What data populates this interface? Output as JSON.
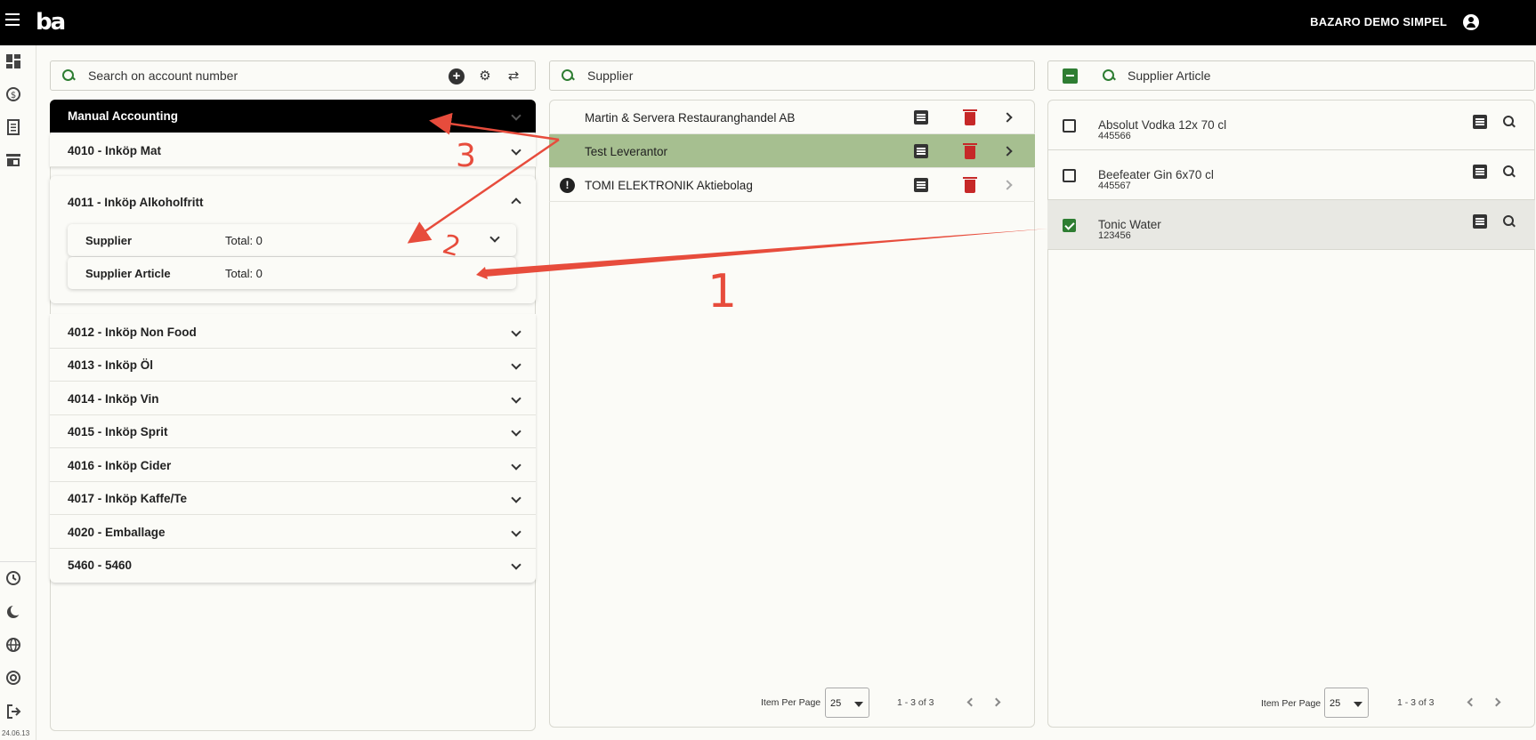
{
  "header": {
    "logo": "ba",
    "company": "BAZARO DEMO SIMPEL"
  },
  "rail": {
    "icons": [
      "dashboard-icon",
      "sync-money-icon",
      "receipt-icon",
      "store-icon",
      "history-icon",
      "dark-mode-icon",
      "globe-icon",
      "support-icon",
      "logout-icon"
    ],
    "version": "24.06.13"
  },
  "accounts": {
    "search_placeholder": "Search on account number",
    "header_label": "Manual Accounting",
    "items": [
      {
        "label": "4010 - Inköp Mat"
      },
      {
        "label": "4011 - Inköp Alkoholfritt"
      },
      {
        "label": "4012 - Inköp Non Food"
      },
      {
        "label": "4013 - Inköp Öl"
      },
      {
        "label": "4014 - Inköp Vin"
      },
      {
        "label": "4015 - Inköp Sprit"
      },
      {
        "label": "4016 - Inköp Cider"
      },
      {
        "label": "4017 - Inköp Kaffe/Te"
      },
      {
        "label": "4020 - Emballage"
      },
      {
        "label": "5460 - 5460"
      }
    ],
    "expanded_subrows": [
      {
        "label": "Supplier",
        "total": "Total: 0"
      },
      {
        "label": "Supplier Article",
        "total": "Total: 0"
      }
    ]
  },
  "suppliers": {
    "search_placeholder": "Supplier",
    "rows": [
      {
        "name": "Martin & Servera Restauranghandel AB",
        "selected": false,
        "warning": false
      },
      {
        "name": "Test Leverantor",
        "selected": true,
        "warning": false
      },
      {
        "name": "TOMI ELEKTRONIK Aktiebolag",
        "selected": false,
        "warning": true
      }
    ],
    "pager": {
      "label": "Item Per Page",
      "per_page": "25",
      "range": "1 - 3 of 3"
    }
  },
  "articles": {
    "search_placeholder": "Supplier Article",
    "rows": [
      {
        "name": "Absolut Vodka 12x 70 cl",
        "number": "445566",
        "checked": false
      },
      {
        "name": "Beefeater Gin 6x70 cl",
        "number": "445567",
        "checked": false
      },
      {
        "name": "Tonic Water",
        "number": "123456",
        "checked": true
      }
    ],
    "pager": {
      "label": "Item Per Page",
      "per_page": "25",
      "range": "1 - 3 of 3"
    }
  },
  "annotations": {
    "color": "#e74c3c",
    "labels": [
      "3",
      "2",
      "1"
    ]
  },
  "colors": {
    "topbar": "#000000",
    "accent_green": "#2e7d32",
    "selected_row": "#a6bf90",
    "delete_red": "#c62828"
  }
}
